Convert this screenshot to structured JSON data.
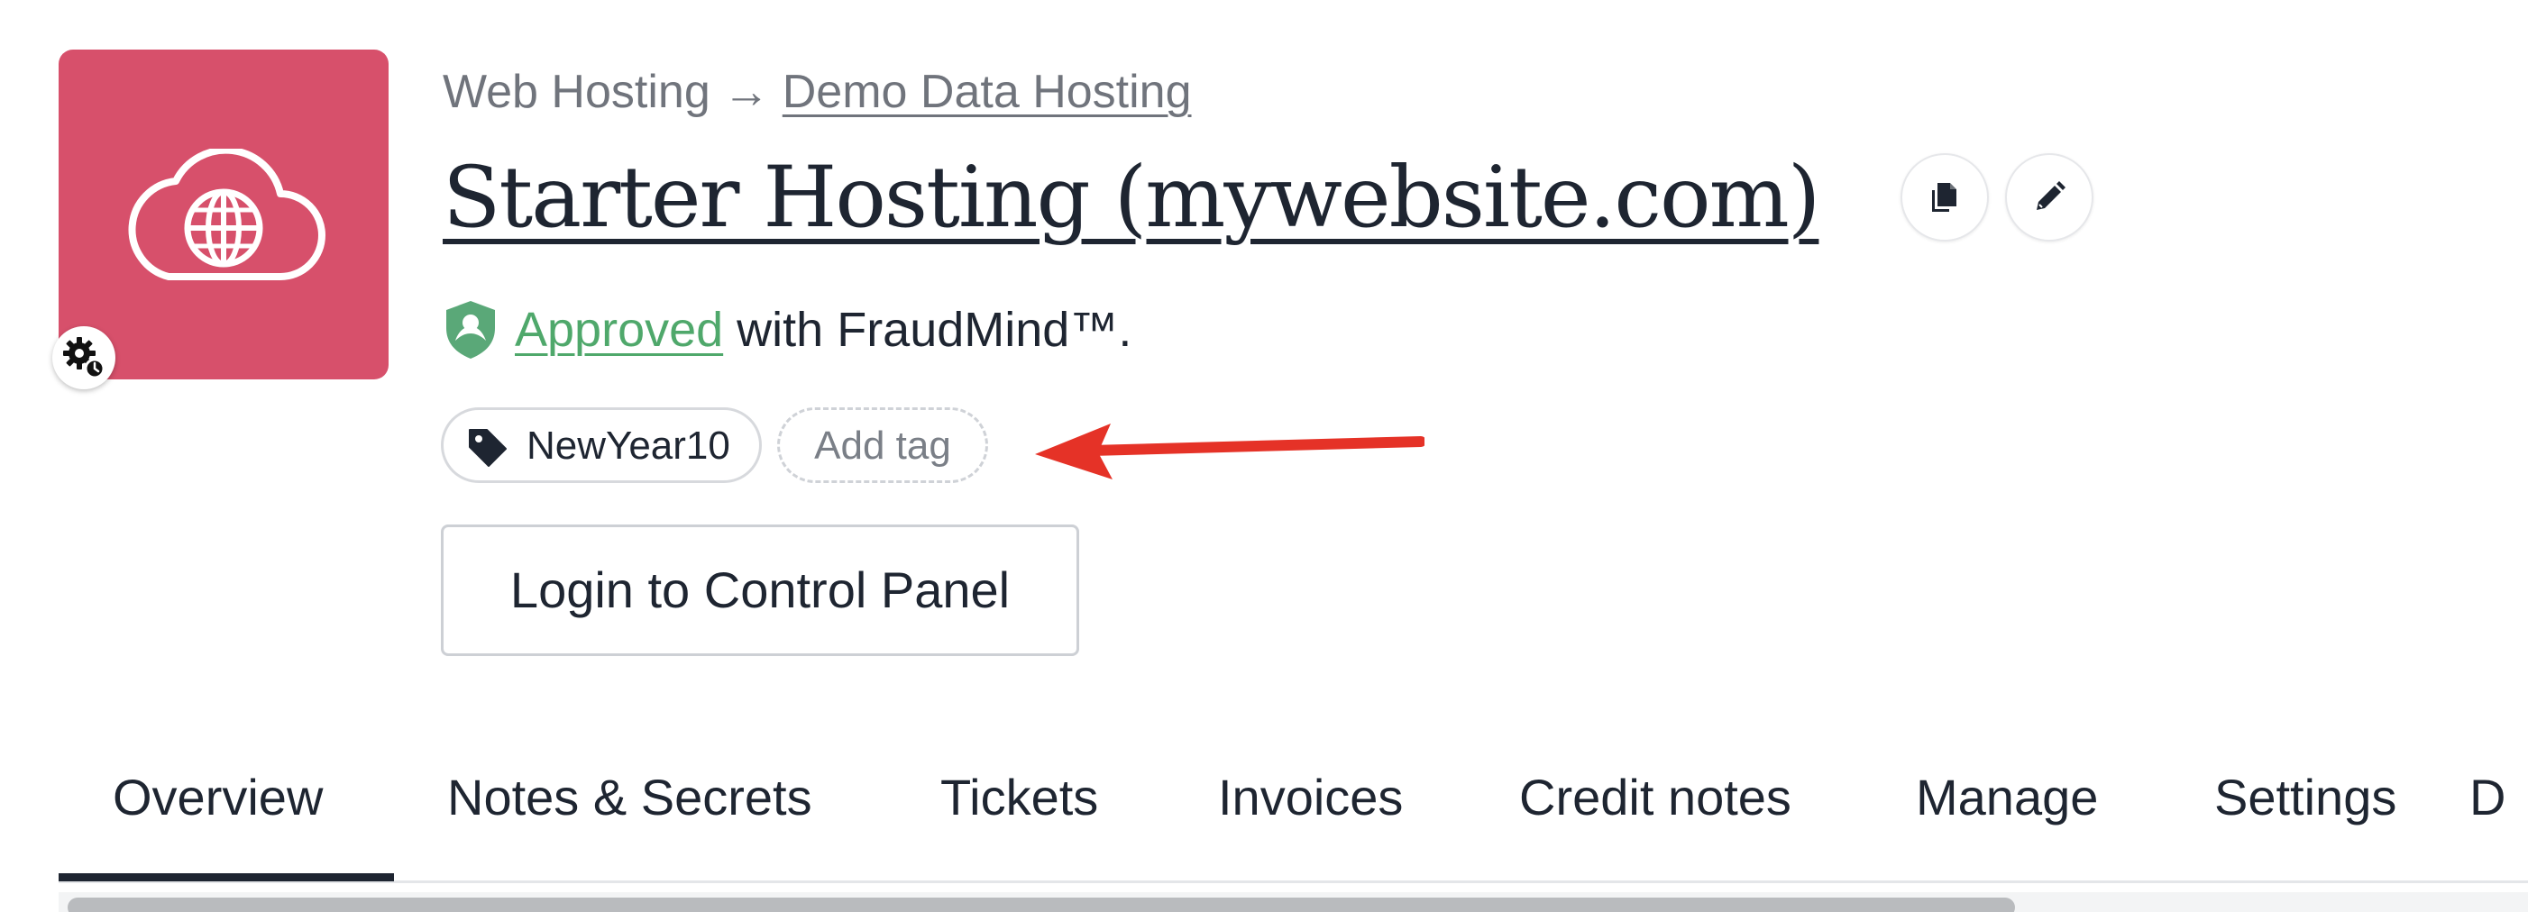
{
  "breadcrumb": {
    "parent": "Web Hosting",
    "separator": "→",
    "current": "Demo Data Hosting"
  },
  "title": "Starter Hosting (mywebsite.com)",
  "icons": {
    "product": "cloud-globe-icon",
    "settings_badge": "gear-icon",
    "copy": "copy-icon",
    "edit": "pencil-icon",
    "fraud": "shield-icon",
    "tag": "tag-icon",
    "annotation": "red-arrow"
  },
  "fraud": {
    "status": "Approved",
    "suffix": " with FraudMind™."
  },
  "tags": {
    "items": [
      "NewYear10"
    ],
    "add_placeholder": "Add tag"
  },
  "control_panel_button": "Login to Control Panel",
  "tabs": [
    {
      "label": "Overview",
      "active": true
    },
    {
      "label": "Notes & Secrets"
    },
    {
      "label": "Tickets"
    },
    {
      "label": "Invoices"
    },
    {
      "label": "Credit notes"
    },
    {
      "label": "Manage"
    },
    {
      "label": "Settings"
    },
    {
      "label": "D"
    }
  ],
  "colors": {
    "product_tile": "#d7506b",
    "approved": "#4fa86b",
    "annotation_arrow": "#e53227",
    "text_primary": "#1e2531"
  }
}
